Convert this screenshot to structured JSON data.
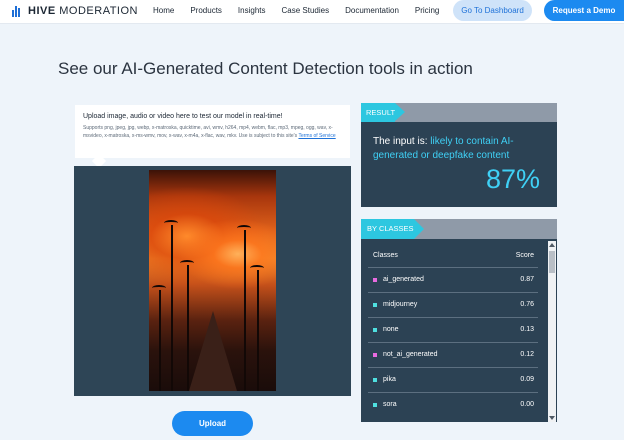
{
  "nav": {
    "brand_bold": "HIVE",
    "brand_light": "MODERATION",
    "links": [
      "Home",
      "Products",
      "Insights",
      "Case Studies",
      "Documentation",
      "Pricing"
    ],
    "dashboard_label": "Go To Dashboard",
    "demo_label": "Request a Demo"
  },
  "headline": "See our AI-Generated Content Detection tools in action",
  "upload": {
    "title": "Upload image, audio or video here to test our model in real-time!",
    "formats": "Supports png, jpeg, jpg, webp, x-matroska, quicktime, avi, wmv, h264, mp4, webm, flac, mp3, mpeg, ogg, wav, x-msvideo, x-matroska, x-ms-wmv, mov, x-wav, x-m4a, x-flac, wav, mkv. Use is subject to this site's",
    "terms_link": "Terms of Service",
    "button_label": "Upload"
  },
  "result": {
    "tag": "RESULT",
    "prefix": "The input is: ",
    "verdict": "likely to contain AI-generated or deepfake content",
    "percent": "87%"
  },
  "classes": {
    "tag": "BY CLASSES",
    "col_class": "Classes",
    "col_score": "Score",
    "rows": [
      {
        "name": "ai_generated",
        "score": "0.87",
        "color": "#e86be0"
      },
      {
        "name": "midjourney",
        "score": "0.76",
        "color": "#4fe0e0"
      },
      {
        "name": "none",
        "score": "0.13",
        "color": "#4fe0e0"
      },
      {
        "name": "not_ai_generated",
        "score": "0.12",
        "color": "#e86be0"
      },
      {
        "name": "pika",
        "score": "0.09",
        "color": "#4fe0e0"
      },
      {
        "name": "sora",
        "score": "0.00",
        "color": "#4fe0e0"
      }
    ]
  },
  "colors": {
    "accent": "#1c8af0",
    "cyan": "#3fd0f5",
    "panel": "#2c4254"
  }
}
